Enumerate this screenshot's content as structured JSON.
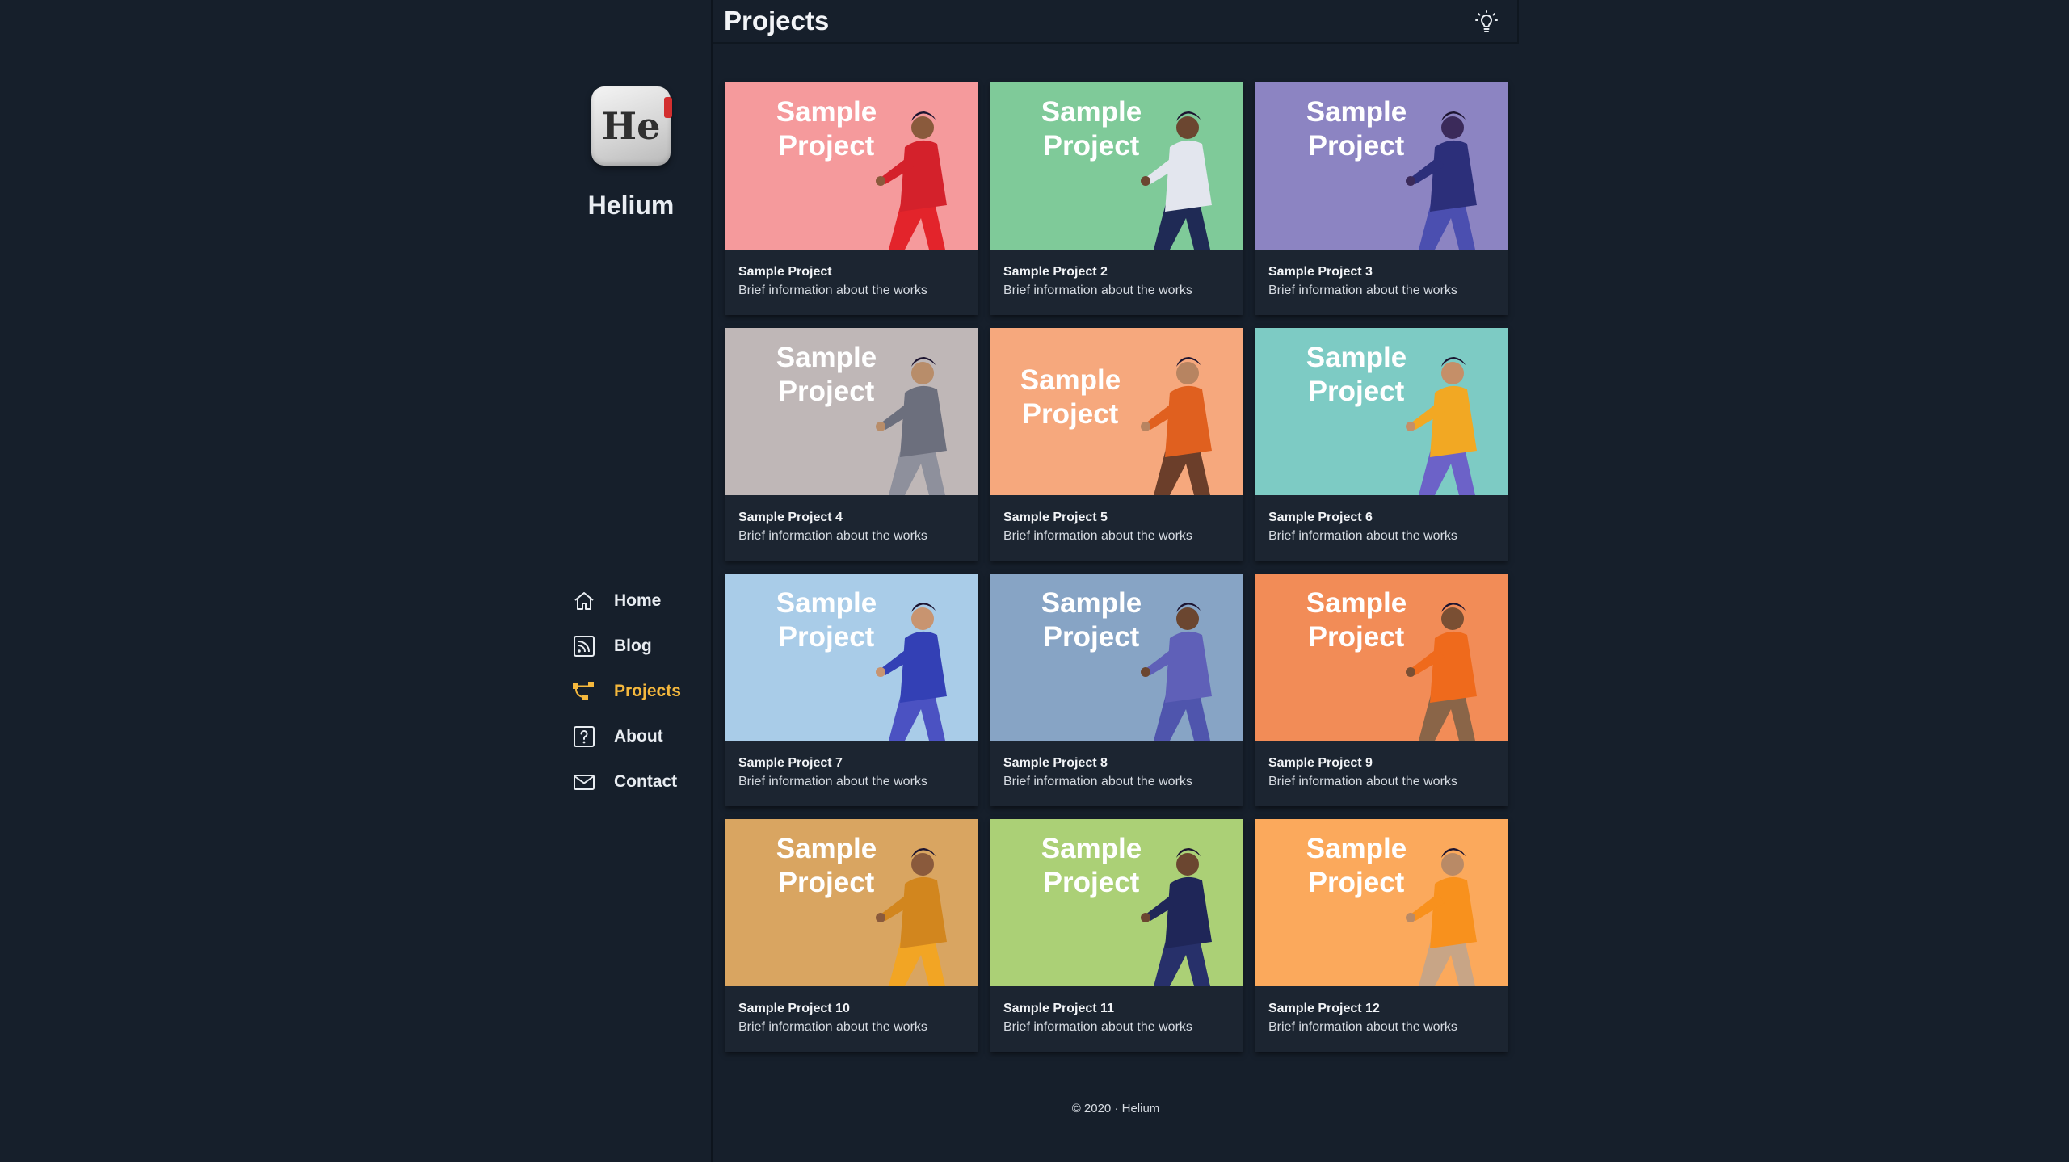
{
  "header": {
    "title": "Projects",
    "theme_toggle_icon": "lightbulb-icon"
  },
  "brand": {
    "logo_text": "He",
    "name": "Helium",
    "logo_accent": "#d32f2f"
  },
  "nav": {
    "active_color": "#f5b83d",
    "items": [
      {
        "label": "Home",
        "icon": "home-icon"
      },
      {
        "label": "Blog",
        "icon": "rss-icon"
      },
      {
        "label": "Projects",
        "icon": "git-branch-icon",
        "active": true
      },
      {
        "label": "About",
        "icon": "question-icon"
      },
      {
        "label": "Contact",
        "icon": "mail-icon"
      }
    ]
  },
  "projects": [
    {
      "thumb_text": "Sample Project",
      "title": "Sample Project",
      "desc": "Brief information about the works",
      "bg": "#f59a9c",
      "shirt": "#d4212b",
      "pants": "#e3242b",
      "skin": "#8a5a3c"
    },
    {
      "thumb_text": "Sample Project",
      "title": "Sample Project 2",
      "desc": "Brief information about the works",
      "bg": "#7fca99",
      "shirt": "#e3e6ee",
      "pants": "#1f2a55",
      "skin": "#6b4630"
    },
    {
      "thumb_text": "Sample Project",
      "title": "Sample Project 3",
      "desc": "Brief information about the works",
      "bg": "#8c84c2",
      "shirt": "#2c2f7a",
      "pants": "#4b4fb0",
      "skin": "#3b2a5a"
    },
    {
      "thumb_text": "Sample Project",
      "title": "Sample Project 4",
      "desc": "Brief information about the works",
      "bg": "#bfb7b7",
      "shirt": "#6c6f7d",
      "pants": "#8e909c",
      "skin": "#b88d6a"
    },
    {
      "thumb_text": "Sample Project",
      "title": "Sample Project 5",
      "desc": "Brief information about the works",
      "bg": "#f6a87d",
      "shirt": "#e0601f",
      "pants": "#6b3e2a",
      "skin": "#b78461"
    },
    {
      "thumb_text": "Sample Project",
      "title": "Sample Project 6",
      "desc": "Brief information about the works",
      "bg": "#7dcbc4",
      "shirt": "#f2a823",
      "pants": "#6c62c8",
      "skin": "#c58f68"
    },
    {
      "thumb_text": "Sample Project",
      "title": "Sample Project 7",
      "desc": "Brief information about the works",
      "bg": "#a9cce8",
      "shirt": "#3340b5",
      "pants": "#4b52c2",
      "skin": "#c89470"
    },
    {
      "thumb_text": "Sample Project",
      "title": "Sample Project 8",
      "desc": "Brief information about the works",
      "bg": "#87a4c5",
      "shirt": "#5f60b8",
      "pants": "#4f55ad",
      "skin": "#6b4630"
    },
    {
      "thumb_text": "Sample Project",
      "title": "Sample Project 9",
      "desc": "Brief information about the works",
      "bg": "#f28c57",
      "shirt": "#ef6a1c",
      "pants": "#8a6548",
      "skin": "#7a4f33"
    },
    {
      "thumb_text": "Sample Project",
      "title": "Sample Project 10",
      "desc": "Brief information about the works",
      "bg": "#d9a561",
      "shirt": "#d2861e",
      "pants": "#f2a524",
      "skin": "#8a5a3c"
    },
    {
      "thumb_text": "Sample Project",
      "title": "Sample Project 11",
      "desc": "Brief information about the works",
      "bg": "#abd076",
      "shirt": "#1f2658",
      "pants": "#27306a",
      "skin": "#6b4630"
    },
    {
      "thumb_text": "Sample Project",
      "title": "Sample Project 12",
      "desc": "Brief information about the works",
      "bg": "#fba95c",
      "shirt": "#f8911d",
      "pants": "#c8a586",
      "skin": "#b98a66"
    }
  ],
  "footer": {
    "text": "© 2020 · Helium"
  }
}
